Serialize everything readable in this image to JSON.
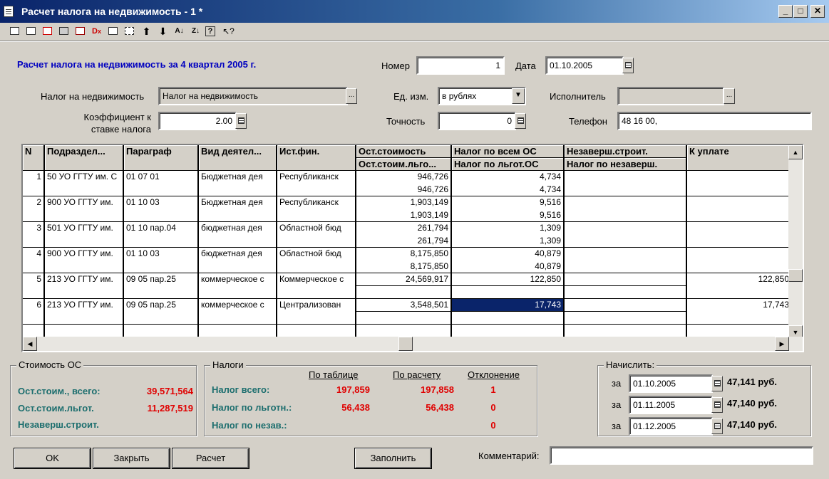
{
  "window": {
    "title": "Расчет налога на недвижимость - 1 *",
    "minimize": "_",
    "maximize": "□",
    "close": "✕"
  },
  "toolbar": {
    "icons": [
      "new-row-icon",
      "edit-row-icon",
      "delete-row-icon",
      "copy-row-icon",
      "clear-icon",
      "delete-x-icon",
      "properties-icon",
      "insert-icon",
      "move-up-icon",
      "move-down-icon",
      "sort-asc-icon",
      "sort-desc-icon",
      "help-icon",
      "whats-this-icon"
    ],
    "up": "⬆",
    "down": "⬇",
    "help": "?"
  },
  "header": {
    "heading": "Расчет налога на недвижимость за 4 квартал 2005 г.",
    "number_label": "Номер",
    "number_value": "1",
    "date_label": "Дата",
    "date_value": "01.10.2005",
    "tax_label": "Налог на недвижимость",
    "tax_value": "Налог на недвижимость",
    "unit_label": "Ед. изм.",
    "unit_value": "в рублях",
    "executor_label": "Исполнитель",
    "executor_value": "",
    "coef_label_1": "Коэффициент к",
    "coef_label_2": "ставке налога",
    "coef_value": "2.00",
    "precision_label": "Точность",
    "precision_value": "0",
    "phone_label": "Телефон",
    "phone_value": "48 16 00,"
  },
  "grid": {
    "columns": {
      "n": "N",
      "subdiv": "Подраздел...",
      "paragraph": "Параграф",
      "activity": "Вид деятел...",
      "source": "Ист.фин.",
      "cost1": "Ост.стоимость",
      "cost2": "Ост.стоим.льго...",
      "tax1": "Налог по всем ОС",
      "tax2": "Налог по льгот.ОС",
      "unf1": "Незаверш.строит.",
      "unf2": "Налог по незаверш.",
      "pay": "К уплате"
    },
    "rows": [
      {
        "n": "1",
        "subdiv": "50 УО ГГТУ им. С",
        "paragraph": "01 07 01",
        "activity": "Бюджетная дея",
        "source": "Республиканск",
        "cost1": "946,726",
        "cost2": "946,726",
        "tax1": "4,734",
        "tax2": "4,734",
        "pay": ""
      },
      {
        "n": "2",
        "subdiv": "900 УО ГГТУ им.",
        "paragraph": "01 10 03",
        "activity": "Бюджетная дея",
        "source": "Республиканск",
        "cost1": "1,903,149",
        "cost2": "1,903,149",
        "tax1": "9,516",
        "tax2": "9,516",
        "pay": ""
      },
      {
        "n": "3",
        "subdiv": "501 УО ГГТУ им.",
        "paragraph": "01 10 пар.04",
        "activity": "бюджетная дея",
        "source": "Областной бюд",
        "cost1": "261,794",
        "cost2": "261,794",
        "tax1": "1,309",
        "tax2": "1,309",
        "pay": ""
      },
      {
        "n": "4",
        "subdiv": "900 УО ГГТУ им.",
        "paragraph": "01 10 03",
        "activity": "бюджетная дея",
        "source": "Областной бюд",
        "cost1": "8,175,850",
        "cost2": "8,175,850",
        "tax1": "40,879",
        "tax2": "40,879",
        "pay": ""
      },
      {
        "n": "5",
        "subdiv": "213 УО ГГТУ им.",
        "paragraph": "09 05 пар.25",
        "activity": "коммерческое с",
        "source": "Коммерческое с",
        "cost1": "24,569,917",
        "cost2": "",
        "tax1": "122,850",
        "tax2": "",
        "pay": "122,850"
      },
      {
        "n": "6",
        "subdiv": "213 УО ГГТУ им.",
        "paragraph": "09 05 пар.25",
        "activity": "коммерческое с",
        "source": "Централизован",
        "cost1": "3,548,501",
        "cost2": "",
        "tax1": "17,743",
        "tax2": "",
        "pay": "17,743"
      }
    ],
    "selected_cell": "row 6, Налог по всем ОС"
  },
  "cost_group": {
    "caption": "Стоимость ОС",
    "total_label": "Ост.стоим., всего:",
    "total_value": "39,571,564",
    "privileged_label": "Ост.стоим.льгот.",
    "privileged_value": "11,287,519",
    "unfinished_label": "Незаверш.строит."
  },
  "taxes_group": {
    "caption": "Налоги",
    "col_table": "По таблице",
    "col_calc": "По расчету",
    "col_dev": "Отклонение",
    "rows": [
      {
        "label": "Налог всего:",
        "table": "197,859",
        "calc": "197,858",
        "dev": "1"
      },
      {
        "label": "Налог по льготн.:",
        "table": "56,438",
        "calc": "56,438",
        "dev": "0"
      },
      {
        "label": "Налог по незав.:",
        "table": "",
        "calc": "",
        "dev": "0"
      }
    ]
  },
  "accrue_group": {
    "caption": "Начислить:",
    "rows": [
      {
        "prefix": "за",
        "date": "01.10.2005",
        "amount": "47,141 руб."
      },
      {
        "prefix": "за",
        "date": "01.11.2005",
        "amount": "47,140 руб."
      },
      {
        "prefix": "за",
        "date": "01.12.2005",
        "amount": "47,140 руб."
      }
    ]
  },
  "buttons": {
    "ok": "OK",
    "close": "Закрыть",
    "calc": "Расчет",
    "fill": "Заполнить"
  },
  "comment": {
    "label": "Комментарий:",
    "value": ""
  },
  "colors": {
    "title_blue": "#0a246a",
    "heading_blue": "#0000c0",
    "label_teal": "#1c6e6e",
    "value_red": "#e00000",
    "window_gray": "#d4d0c8"
  }
}
